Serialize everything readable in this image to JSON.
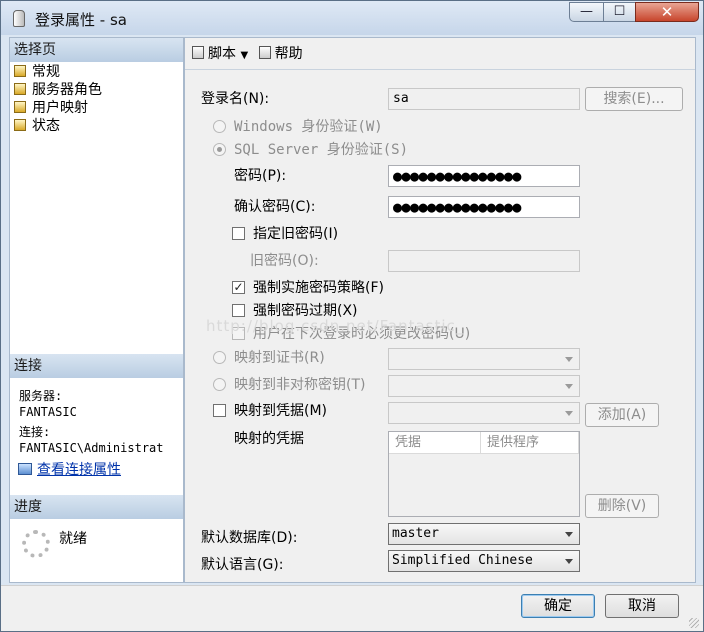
{
  "window": {
    "title": "登录属性 - sa",
    "minimize": "—",
    "maximize": "☐",
    "close": "✕"
  },
  "sidebar": {
    "select_page_heading": "选择页",
    "items": [
      {
        "label": "常规",
        "icon": "page-icon"
      },
      {
        "label": "服务器角色",
        "icon": "page-icon"
      },
      {
        "label": "用户映射",
        "icon": "page-icon"
      },
      {
        "label": "状态",
        "icon": "page-icon"
      }
    ],
    "connection_heading": "连接",
    "server_label": "服务器:",
    "server_value": "FANTASIC",
    "connection_label": "连接:",
    "connection_value": "FANTASIC\\Administrat",
    "view_connection_link": "查看连接属性",
    "progress_heading": "进度",
    "progress_status": "就绪"
  },
  "toolbar": {
    "script_label": "脚本",
    "help_label": "帮助"
  },
  "form": {
    "login_name_label": "登录名(N):",
    "login_name_value": "sa",
    "search_button": "搜索(E)...",
    "windows_auth_label": "Windows 身份验证(W)",
    "sql_auth_label": "SQL Server 身份验证(S)",
    "password_label": "密码(P):",
    "password_value": "●●●●●●●●●●●●●●●",
    "confirm_password_label": "确认密码(C):",
    "confirm_password_value": "●●●●●●●●●●●●●●●",
    "specify_old_password_label": "指定旧密码(I)",
    "old_password_label": "旧密码(O):",
    "enforce_policy_label": "强制实施密码策略(F)",
    "enforce_policy_checked": true,
    "enforce_expiration_label": "强制密码过期(X)",
    "enforce_expiration_checked": false,
    "must_change_label": "用户在下次登录时必须更改密码(U)",
    "map_to_certificate_label": "映射到证书(R)",
    "map_to_asymmetric_key_label": "映射到非对称密钥(T)",
    "map_to_credential_label": "映射到凭据(M)",
    "add_button": "添加(A)",
    "mapped_credentials_label": "映射的凭据",
    "credentials_table_headers": [
      "凭据",
      "提供程序"
    ],
    "remove_button": "删除(V)",
    "default_database_label": "默认数据库(D):",
    "default_database_value": "master",
    "default_language_label": "默认语言(G):",
    "default_language_value": "Simplified Chinese"
  },
  "watermark": "http://blog.csdn.net/Fantastic_",
  "buttons": {
    "ok": "确定",
    "cancel": "取消"
  }
}
